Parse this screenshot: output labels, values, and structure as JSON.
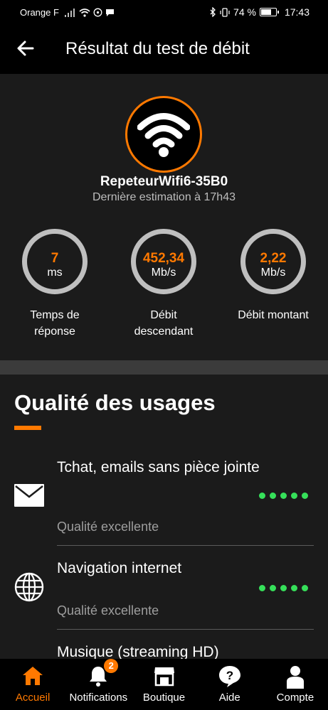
{
  "status_bar": {
    "carrier": "Orange F",
    "battery_text": "74 %",
    "battery_level": 0.74,
    "time": "17:43"
  },
  "header": {
    "title": "Résultat du test de débit"
  },
  "device": {
    "name": "RepeteurWifi6-35B0",
    "estimation": "Dernière estimation à 17h43"
  },
  "metrics": [
    {
      "value": "7",
      "unit": "ms",
      "label_line1": "Temps de",
      "label_line2": "réponse"
    },
    {
      "value": "452,34",
      "unit": "Mb/s",
      "label_line1": "Débit",
      "label_line2": "descendant"
    },
    {
      "value": "2,22",
      "unit": "Mb/s",
      "label_line1": "Débit montant",
      "label_line2": ""
    }
  ],
  "quality": {
    "title": "Qualité des usages",
    "items": [
      {
        "name": "Tchat, emails sans pièce jointe",
        "quality": "Qualité excellente",
        "icon": "envelope-icon",
        "dots_filled": 5,
        "dots_total": 5
      },
      {
        "name": "Navigation internet",
        "quality": "Qualité excellente",
        "icon": "globe-icon",
        "dots_filled": 5,
        "dots_total": 5
      },
      {
        "name": "Musique (streaming HD)",
        "quality": "",
        "icon": "",
        "dots_filled": 0,
        "dots_total": 0
      }
    ]
  },
  "nav": {
    "items": [
      {
        "label": "Accueil",
        "icon": "home-icon",
        "active": true
      },
      {
        "label": "Notifications",
        "icon": "bell-icon",
        "badge": "2"
      },
      {
        "label": "Boutique",
        "icon": "shop-icon"
      },
      {
        "label": "Aide",
        "icon": "help-icon"
      },
      {
        "label": "Compte",
        "icon": "account-icon"
      }
    ]
  },
  "colors": {
    "accent": "#ff7900",
    "quality_dot": "#36e05a",
    "panel": "#1b1b1b",
    "ring": "#bfbfbf"
  }
}
